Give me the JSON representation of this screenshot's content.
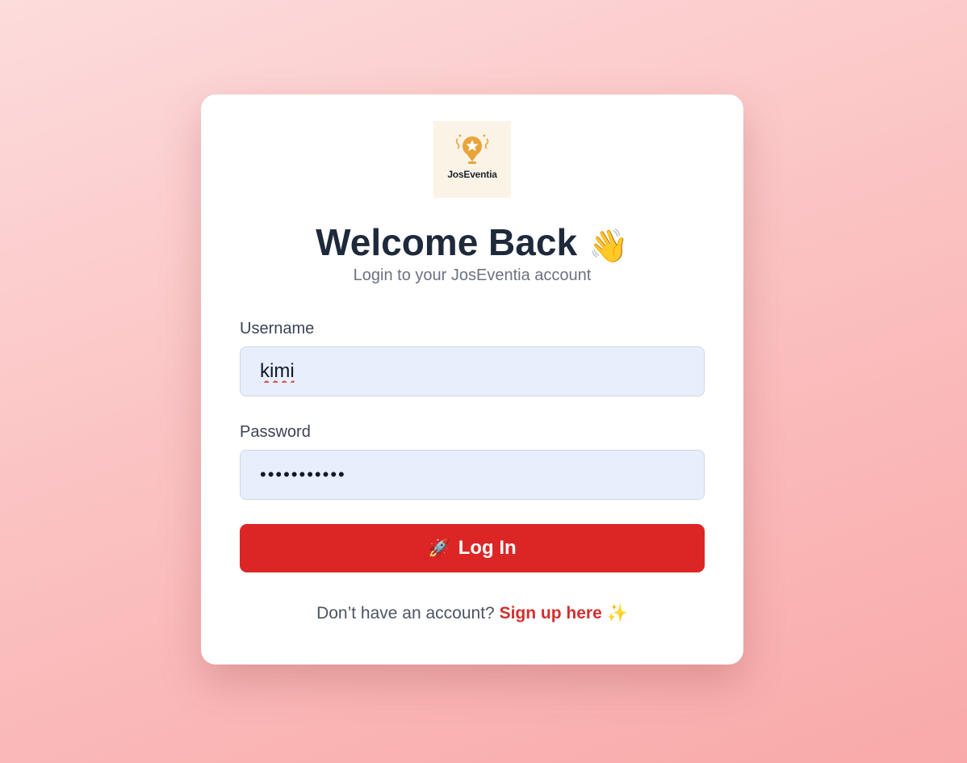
{
  "logo": {
    "text": "JosEventia",
    "icon": "trophy-star-icon",
    "accent": "#e8a33a"
  },
  "header": {
    "title": "Welcome Back",
    "title_emoji": "👋",
    "subtitle": "Login to your JosEventia account"
  },
  "form": {
    "username_label": "Username",
    "username_value": "kimi",
    "password_label": "Password",
    "password_value": "•••••••••••",
    "login_icon": "🚀",
    "login_label": "Log In"
  },
  "footer": {
    "prompt": "Don’t have an account?",
    "signup_link": "Sign up here",
    "sparkle": "✨"
  },
  "colors": {
    "primary": "#dc2626",
    "link": "#d32f2f",
    "input_bg": "#e7effd",
    "title": "#1e2a3b"
  }
}
